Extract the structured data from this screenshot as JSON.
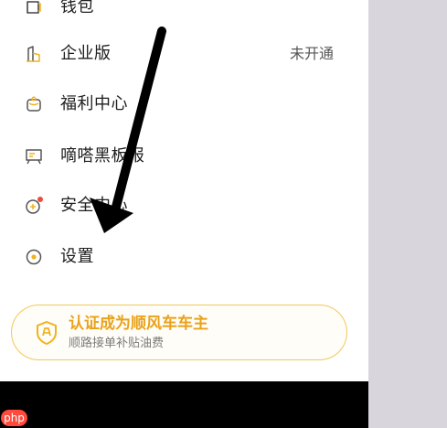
{
  "menu": {
    "items": [
      {
        "label": "钱包",
        "value": "",
        "icon": "wallet-icon"
      },
      {
        "label": "企业版",
        "value": "未开通",
        "icon": "enterprise-icon"
      },
      {
        "label": "福利中心",
        "value": "",
        "icon": "benefits-icon"
      },
      {
        "label": "嘀嗒黑板报",
        "value": "",
        "icon": "blackboard-icon"
      },
      {
        "label": "安全中心",
        "value": "",
        "icon": "safety-icon"
      },
      {
        "label": "设置",
        "value": "",
        "icon": "settings-icon"
      }
    ]
  },
  "promo": {
    "title": "认证成为顺风车车主",
    "subtitle": "顺路接单补贴油费",
    "icon": "shield-icon"
  },
  "annotation": {
    "icon": "arrow-icon"
  },
  "watermark": {
    "text": "php"
  },
  "colors": {
    "accent": "#f0b21d",
    "promo_border": "#f0c85d",
    "promo_title": "#e9a21b",
    "badge": "#f04b3c",
    "background": "#ffffff",
    "overlay": "#d8d5dc",
    "bottom_bar": "#000000"
  }
}
